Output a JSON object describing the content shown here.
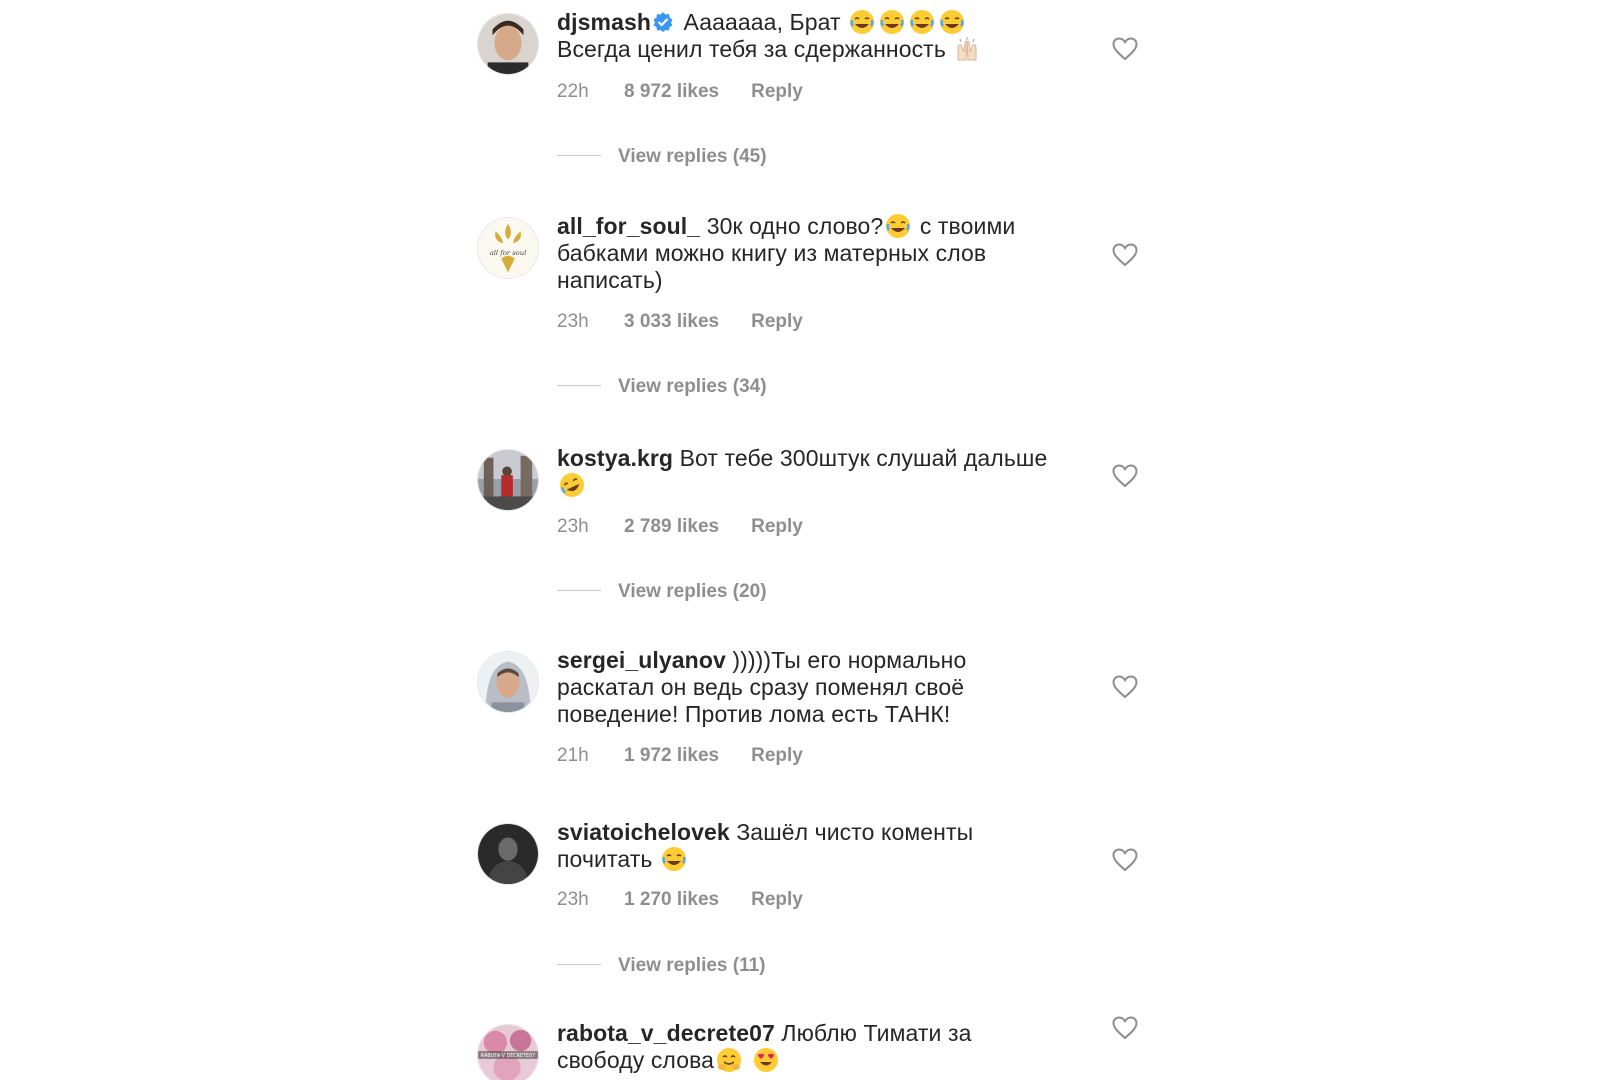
{
  "comments": [
    {
      "username": "djsmash",
      "verified": true,
      "text": "Ааааааа, Брат",
      "text2": "Всегда ценил тебя за сдержанность",
      "time": "22h",
      "likes": "8 972 likes",
      "reply": "Reply",
      "view_replies": "View replies (45)"
    },
    {
      "username": "all_for_soul_",
      "text": "30к одно слово?",
      "text2": "с твоими бабками можно книгу из матерных слов написать)",
      "time": "23h",
      "likes": "3 033 likes",
      "reply": "Reply",
      "view_replies": "View replies (34)",
      "avatar_text": "all for soul"
    },
    {
      "username": "kostya.krg",
      "text": "Вот тебе 300штук слушай дальше",
      "time": "23h",
      "likes": "2 789 likes",
      "reply": "Reply",
      "view_replies": "View replies (20)"
    },
    {
      "username": "sergei_ulyanov",
      "text": ")))))Ты его нормально раскатал он ведь сразу поменял своё поведение! Против лома есть ТАНК!",
      "time": "21h",
      "likes": "1 972 likes",
      "reply": "Reply"
    },
    {
      "username": "sviatoichelovek",
      "text": "Зашёл чисто коменты почитать",
      "time": "23h",
      "likes": "1 270 likes",
      "reply": "Reply",
      "view_replies": "View replies (11)"
    },
    {
      "username": "rabota_v_decrete07",
      "text": "Люблю Тимати за свободу слова",
      "avatar_text": "RABOTA V DECRETE07"
    }
  ],
  "colors": {
    "text": "#262626",
    "secondary": "#8e8e8e",
    "verified_blue": "#3897f0",
    "divider": "#c7c7c7"
  },
  "icons": [
    "heart-outline-icon",
    "verified-badge-icon",
    "joy-emoji",
    "raised-hands-emoji",
    "rofl-emoji",
    "smiling-hug-emoji",
    "heart-eyes-emoji"
  ]
}
